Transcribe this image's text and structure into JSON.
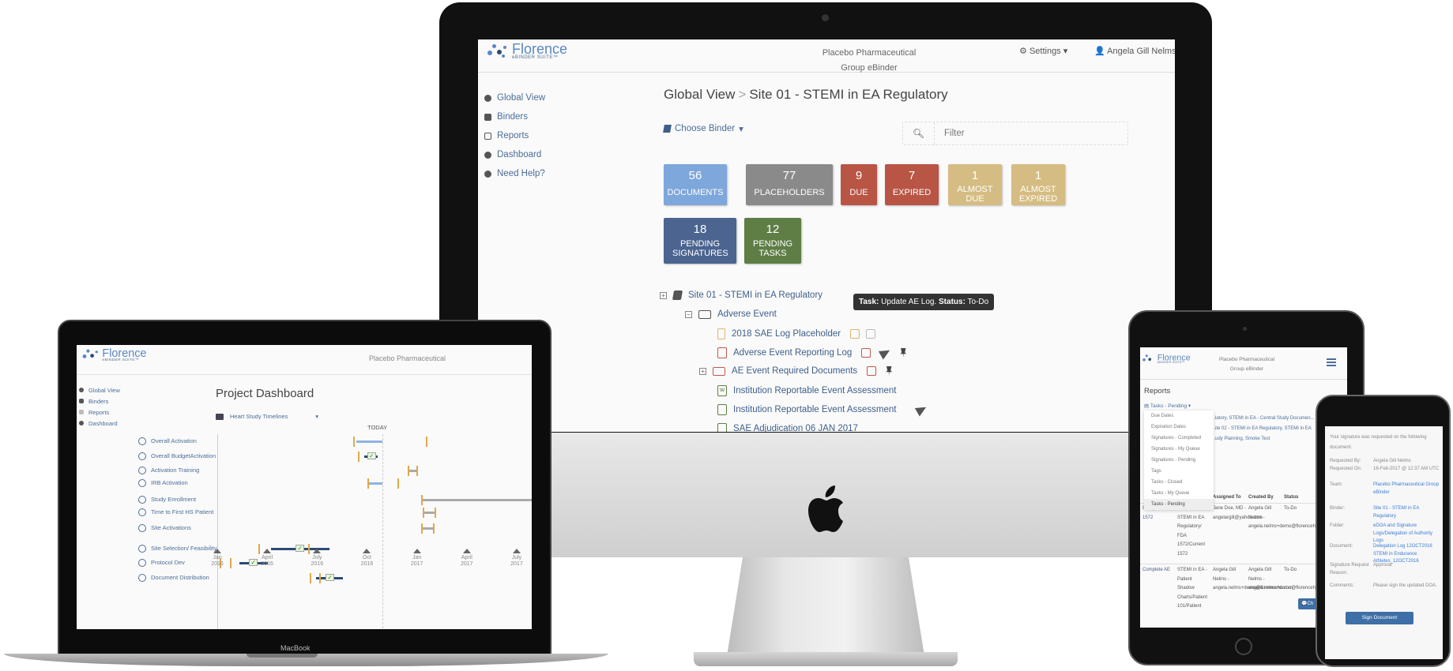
{
  "imac": {
    "logo": {
      "brand": "Florence",
      "sub": "eBINDER SUITE™"
    },
    "header": {
      "company_line1": "Placebo Pharmaceutical",
      "company_line2": "Group eBinder",
      "settings_label": "Settings",
      "user_label": "Angela Gill Nelms"
    },
    "sidebar": {
      "items": [
        {
          "label": "Global View",
          "icon": "globe-icon"
        },
        {
          "label": "Binders",
          "icon": "archive-icon"
        },
        {
          "label": "Reports",
          "icon": "report-icon"
        },
        {
          "label": "Dashboard",
          "icon": "dashboard-icon"
        },
        {
          "label": "Need Help?",
          "icon": "question-icon"
        }
      ]
    },
    "breadcrumb": {
      "root": "Global View",
      "separator": ">",
      "current": "Site 01 - STEMI in EA Regulatory"
    },
    "choose_binder_label": "Choose Binder",
    "filter": {
      "placeholder": "Filter",
      "value": ""
    },
    "tiles": [
      {
        "count": "56",
        "label": "DOCUMENTS",
        "color": "#7ea7db"
      },
      {
        "count": "77",
        "label": "PLACEHOLDERS",
        "color": "#8a8a8a"
      },
      {
        "count": "9",
        "label": "DUE",
        "color": "#b85545"
      },
      {
        "count": "7",
        "label": "EXPIRED",
        "color": "#b85545"
      },
      {
        "count": "1",
        "label": "ALMOST DUE",
        "color": "#d5bc82"
      },
      {
        "count": "1",
        "label": "ALMOST EXPIRED",
        "color": "#d5bc82"
      },
      {
        "count": "18",
        "label": "PENDING SIGNATURES",
        "color": "#4b6490"
      },
      {
        "count": "12",
        "label": "PENDING TASKS",
        "color": "#5e7e45"
      }
    ],
    "tree": [
      {
        "label": "Site 01 - STEMI in EA Regulatory",
        "type": "binder"
      },
      {
        "label": "Adverse Event",
        "type": "folder-open"
      },
      {
        "label": "2018 SAE Log Placeholder",
        "type": "placeholder"
      },
      {
        "label": "Adverse Event Reporting Log",
        "type": "pdf"
      },
      {
        "label": "AE Event Required Documents",
        "type": "folder"
      },
      {
        "label": "Institution Reportable Event Assessment",
        "type": "word"
      },
      {
        "label": "Institution Reportable Event Assessment",
        "type": "pdf-green"
      },
      {
        "label": "SAE Adjudication 06 JAN 2017",
        "type": "image"
      }
    ],
    "tooltip": {
      "task_key": "Task:",
      "task_val": "Update AE Log.",
      "status_key": "Status:",
      "status_val": "To-Do"
    }
  },
  "laptop": {
    "logo": {
      "brand": "Florence",
      "sub": "eBINDER SUITE™"
    },
    "company": "Placebo Pharmaceutical",
    "sidebar": [
      "Global View",
      "Binders",
      "Reports",
      "Dashboard"
    ],
    "title": "Project Dashboard",
    "timeline_select": "Heart Study Timelines",
    "today_label": "TODAY",
    "device_label": "MacBook"
  },
  "chart_data": {
    "type": "gantt",
    "title": "Heart Study Timelines",
    "today": "2016-10",
    "categories": [
      "Overall Activation",
      "Overall BudgetActivation",
      "Activation Training",
      "IRB Activation",
      "Study Enrollment",
      "Time to First HS Patient",
      "Site Activations",
      "Site Selection/ Feasibility",
      "Protocol Dev",
      "Document Distribution"
    ],
    "x_ticks": [
      "Jan 2016",
      "April 2016",
      "July 2016",
      "Oct 2016",
      "Jan 2017",
      "April 2017",
      "July 2017"
    ],
    "xlim": [
      0,
      19
    ],
    "tasks": [
      {
        "name": "Overall Activation",
        "milestones": [
          8.1,
          12.5
        ],
        "bar": [
          8.3,
          9.9
        ],
        "status": "in-progress",
        "complete": false
      },
      {
        "name": "Overall BudgetActivation",
        "milestones": [
          8.4
        ],
        "bar": [
          8.8,
          9.6
        ],
        "status": "done",
        "complete": true
      },
      {
        "name": "Activation Training",
        "milestones": [
          11.4,
          11.9
        ],
        "bar": [
          11.4,
          11.9
        ],
        "status": "future",
        "complete": false
      },
      {
        "name": "IRB Activation",
        "milestones": [
          9.0,
          10.8
        ],
        "bar": [
          9.0,
          9.9
        ],
        "status": "in-progress",
        "complete": false
      },
      {
        "name": "Study Enrollment",
        "milestones": [
          12.2
        ],
        "bar": [
          12.2,
          19
        ],
        "status": "future",
        "complete": false
      },
      {
        "name": "Time to First HS Patient",
        "milestones": [
          12.3,
          13.0
        ],
        "bar": [
          12.3,
          13.0
        ],
        "status": "future",
        "complete": false
      },
      {
        "name": "Site Activations",
        "milestones": [
          12.2,
          12.9
        ],
        "bar": [
          12.2,
          12.9
        ],
        "status": "future",
        "complete": false
      },
      {
        "name": "Site Selection/ Feasibility",
        "milestones": [
          2.4,
          5.4
        ],
        "bar": [
          3.2,
          6.7
        ],
        "status": "done",
        "complete": true,
        "check": 4.9
      },
      {
        "name": "Protocol Dev",
        "milestones": [
          0.1,
          0.7
        ],
        "bar": [
          1.3,
          3.0
        ],
        "status": "done",
        "complete": true,
        "check": 2.1
      },
      {
        "name": "Document Distribution",
        "milestones": [
          5.5,
          6.1
        ],
        "bar": [
          5.9,
          7.5
        ],
        "status": "done",
        "complete": true,
        "check": 6.7
      }
    ]
  },
  "tablet": {
    "logo": {
      "brand": "Florence",
      "sub": "eBINDER SUITE™"
    },
    "company_line1": "Placebo Pharmaceutical",
    "company_line2": "Group eBinder",
    "title": "Reports",
    "report_select": "Tasks - Pending",
    "filter_lines": [
      "...latory, STEMI in EA - Central Study Documen...",
      "...ite 02 - STEMI in EA Regulatory, STEMI in EA",
      "...udy Planning, Smoke Test"
    ],
    "menu_items": [
      "Due Dates",
      "Expiration Dates",
      "Signatures - Completed",
      "Signatures - My Queue",
      "Signatures - Pending",
      "Tags",
      "Tasks - Closed",
      "Tasks - My Queue",
      "Tasks - Pending"
    ],
    "menu_active": "Tasks - Pending",
    "table": {
      "headers": [
        "",
        "",
        "Assigned To",
        "Created By",
        "Status"
      ],
      "rows": [
        [
          "Complete 1572",
          "Site 01 - STEMI in EA Regulatory/ FDA 1572/Current 1572",
          "Jane Doe, MD - angelargill@yahoo.com",
          "Angela Gill Nelms - angela.nelms+demo@florencehc.com",
          "To-Do"
        ],
        [
          "Complete AE",
          "STEMI in EA - Patient Shadow Charts/Patient 101/Patient",
          "Angela Gill Nelms - angela.nelms+demo@florencehc.com",
          "Angela Gill Nelms - angela.nelms+demo@florencehc.com",
          "To-Do"
        ]
      ]
    },
    "chat_label": "Ch"
  },
  "phone": {
    "intro": "Your signature was requested on the following document:",
    "fields": [
      {
        "key": "Requested By:",
        "value": "Angela Gill Nelms",
        "link": false
      },
      {
        "key": "Requested On:",
        "value": "16-Feb-2017 @ 12:37 AM UTC",
        "link": false
      },
      {
        "key": "Team:",
        "value": "Placebo Pharmaceutical Group eBinder",
        "link": true
      },
      {
        "key": "Binder:",
        "value": "Site 01 - STEMI in EA Regulatory",
        "link": true
      },
      {
        "key": "Folder:",
        "value": "eDOA and Signature Logs/Delegation of Authority Logs",
        "link": true
      },
      {
        "key": "Document:",
        "value": "Delegation Log 12OCT2016 STEMI in Endurance Athletes_12OCT2016",
        "link": true
      },
      {
        "key": "Signature Request Reason:",
        "value": "Approval",
        "link": false
      },
      {
        "key": "Comments:",
        "value": "Please sign the updated DOA.",
        "link": false
      }
    ],
    "sign_button": "Sign Document"
  }
}
